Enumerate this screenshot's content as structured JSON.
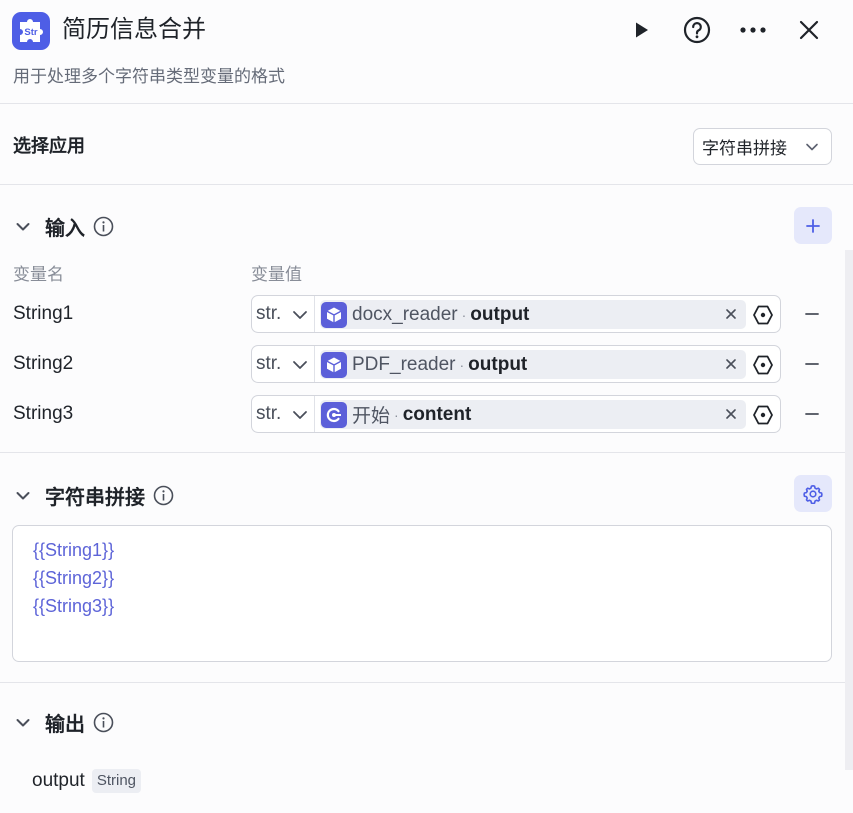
{
  "header": {
    "title": "简历信息合并",
    "description": "用于处理多个字符串类型变量的格式",
    "app_icon_text": "Str"
  },
  "select_app": {
    "label": "选择应用",
    "value": "字符串拼接"
  },
  "inputs": {
    "title": "输入",
    "col_name": "变量名",
    "col_value": "变量值",
    "rows": [
      {
        "name": "String1",
        "type": "str.",
        "node": "docx_reader",
        "field": "output",
        "icon": "cube-icon"
      },
      {
        "name": "String2",
        "type": "str.",
        "node": "PDF_reader",
        "field": "output",
        "icon": "cube-icon"
      },
      {
        "name": "String3",
        "type": "str.",
        "node": "开始",
        "field": "content",
        "icon": "start-node-icon"
      }
    ]
  },
  "concat": {
    "title": "字符串拼接",
    "lines": [
      "{{String1}}",
      "{{String2}}",
      "{{String3}}"
    ]
  },
  "output": {
    "title": "输出",
    "name": "output",
    "type": "String"
  },
  "colors": {
    "accent": "#4e5ee6",
    "accent_light": "#e5e8fb",
    "template_text": "#5d64d8"
  }
}
